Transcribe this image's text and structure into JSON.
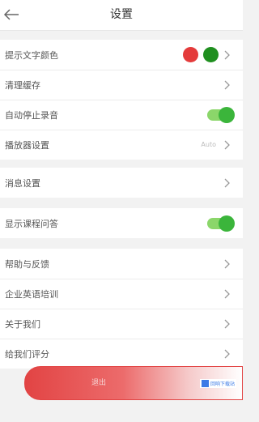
{
  "header": {
    "title": "设置",
    "back_icon": "arrow-left-icon"
  },
  "groups": [
    {
      "items": [
        {
          "label": "提示文字颜色",
          "colors": [
            "#e43b3b",
            "#1f8f1f"
          ]
        },
        {
          "label": "清理缓存"
        },
        {
          "label": "自动停止录音",
          "toggle": true
        },
        {
          "label": "播放器设置",
          "value": "Auto"
        }
      ]
    },
    {
      "items": [
        {
          "label": "消息设置"
        }
      ]
    },
    {
      "items": [
        {
          "label": "显示课程问答",
          "toggle": true
        }
      ]
    },
    {
      "items": [
        {
          "label": "帮助与反馈"
        },
        {
          "label": "企业英语培训"
        },
        {
          "label": "关于我们"
        },
        {
          "label": "给我们评分"
        }
      ]
    }
  ],
  "bottom_bar": {
    "label": "退出",
    "color": "#e24444"
  },
  "watermark": {
    "text": "回响下载站"
  },
  "colors": {
    "toggle_on": "#3bb53b",
    "accent": "#e24444"
  }
}
